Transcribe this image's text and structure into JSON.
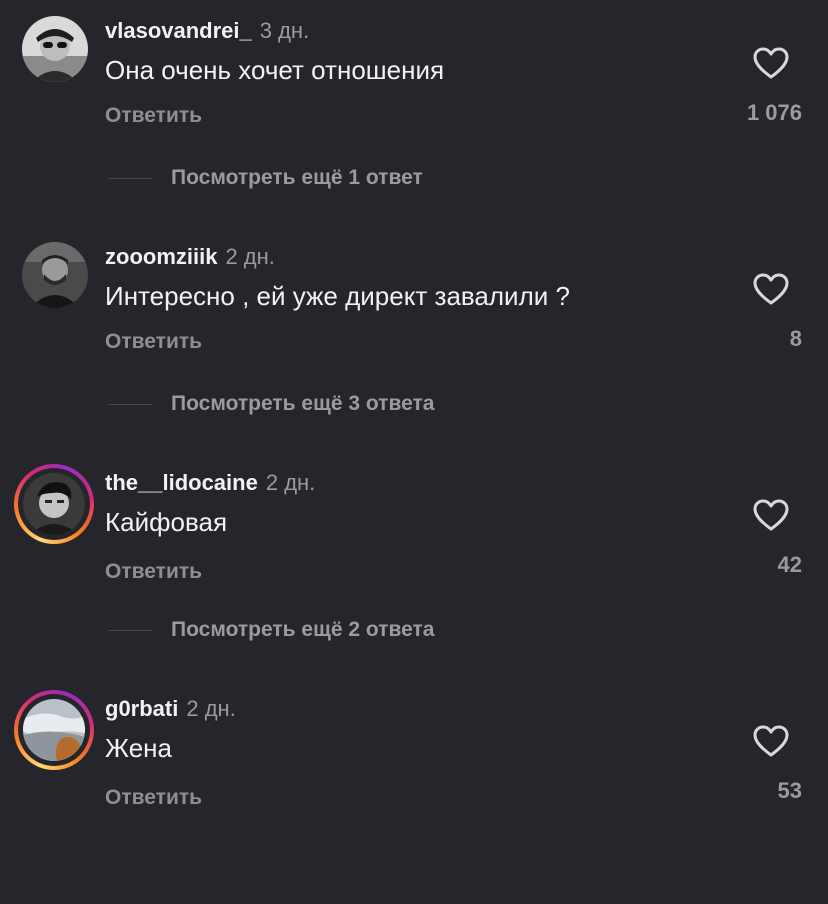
{
  "comments": [
    {
      "username": "vlasovandrei_",
      "time": "3 дн.",
      "text": "Она очень хочет отношения",
      "reply_label": "Ответить",
      "likes": "1 076",
      "more_replies": "Посмотреть ещё 1 ответ",
      "avatar_story": false,
      "avatar_icon": "avatar-photo"
    },
    {
      "username": "zooomziiik",
      "time": "2 дн.",
      "text": "Интересно , ей уже директ завалили ?",
      "reply_label": "Ответить",
      "likes": "8",
      "more_replies": "Посмотреть ещё 3 ответа",
      "avatar_story": false,
      "avatar_icon": "avatar-photo"
    },
    {
      "username": "the__lidocaine",
      "time": "2 дн.",
      "text": "Кайфовая",
      "reply_label": "Ответить",
      "likes": "42",
      "more_replies": "Посмотреть ещё 2 ответа",
      "avatar_story": true,
      "avatar_icon": "avatar-photo"
    },
    {
      "username": "g0rbati",
      "time": "2 дн.",
      "text": "Жена",
      "reply_label": "Ответить",
      "likes": "53",
      "avatar_story": true,
      "avatar_icon": "avatar-photo"
    }
  ],
  "colors": {
    "background": "#25262b",
    "primary_text": "#f2f2f2",
    "secondary_text": "#9a9ba0",
    "story_ring": [
      "#feda75",
      "#fa7e1e",
      "#d62976",
      "#962fbf"
    ]
  },
  "icons": {
    "like": "heart-outline-icon"
  }
}
